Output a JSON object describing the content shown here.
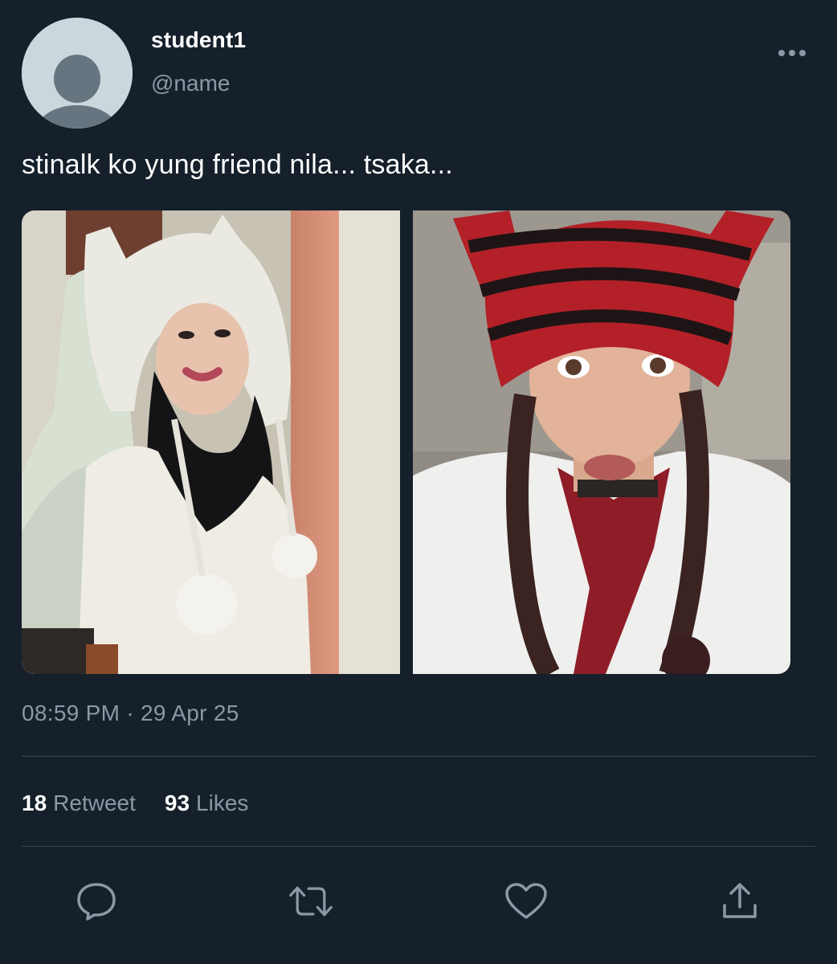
{
  "tweet": {
    "display_name": "student1",
    "handle": "@name",
    "text": "stinalk ko yung friend nila... tsaka...",
    "timestamp": "08:59 PM · 29 Apr 25",
    "media": [
      {
        "description": "girl in white knit cat-ear hood with pompoms beside mirror"
      },
      {
        "description": "girl in red and black striped cat-ear beanie with braids"
      }
    ]
  },
  "stats": {
    "retweet_count": "18",
    "retweet_label": "Retweet",
    "like_count": "93",
    "like_label": "Likes"
  },
  "icons": {
    "more": "more-horizontal-icon",
    "reply": "comment-bubble-icon",
    "retweet": "retweet-arrows-icon",
    "like": "heart-icon",
    "share": "share-upload-icon"
  },
  "colors": {
    "background": "#15202b",
    "secondary_text": "#8b98a5",
    "divider": "#38444d",
    "icon": "#8b98a5"
  }
}
